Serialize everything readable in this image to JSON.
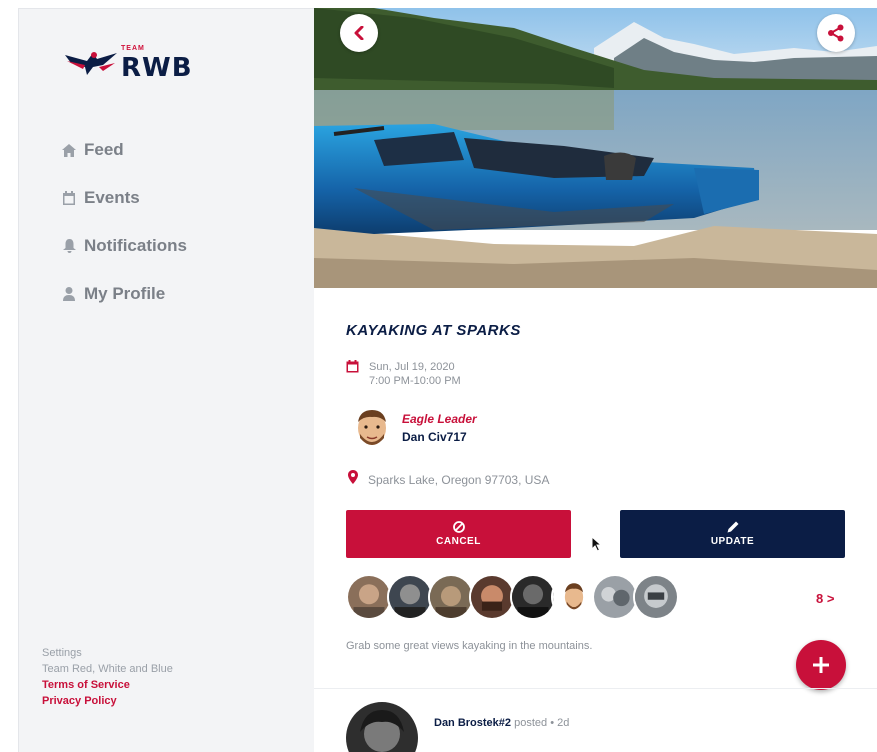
{
  "brand": {
    "team": "TEAM",
    "name": "RWB"
  },
  "nav": [
    {
      "label": "Feed",
      "icon": "home-icon"
    },
    {
      "label": "Events",
      "icon": "calendar-icon"
    },
    {
      "label": "Notifications",
      "icon": "bell-icon"
    },
    {
      "label": "My Profile",
      "icon": "user-icon"
    }
  ],
  "footer": {
    "settings": "Settings",
    "org": "Team Red, White and Blue",
    "terms": "Terms of Service",
    "privacy": "Privacy Policy"
  },
  "event": {
    "title": "KAYAKING AT SPARKS",
    "date": "Sun, Jul 19, 2020",
    "time": "7:00 PM-10:00 PM",
    "leader_role": "Eagle Leader",
    "leader_name": "Dan Civ717",
    "location": "Sparks Lake, Oregon 97703, USA",
    "description": "Grab some great views kayaking in the mountains.",
    "more_attendees": "8 >"
  },
  "actions": {
    "cancel": "CANCEL",
    "update": "UPDATE"
  },
  "post": {
    "author": "Dan Brostek#2",
    "meta": "posted • 2d"
  },
  "colors": {
    "accent_red": "#c8103a",
    "navy": "#0b1d45",
    "sidebar_bg": "#f3f4f6"
  }
}
